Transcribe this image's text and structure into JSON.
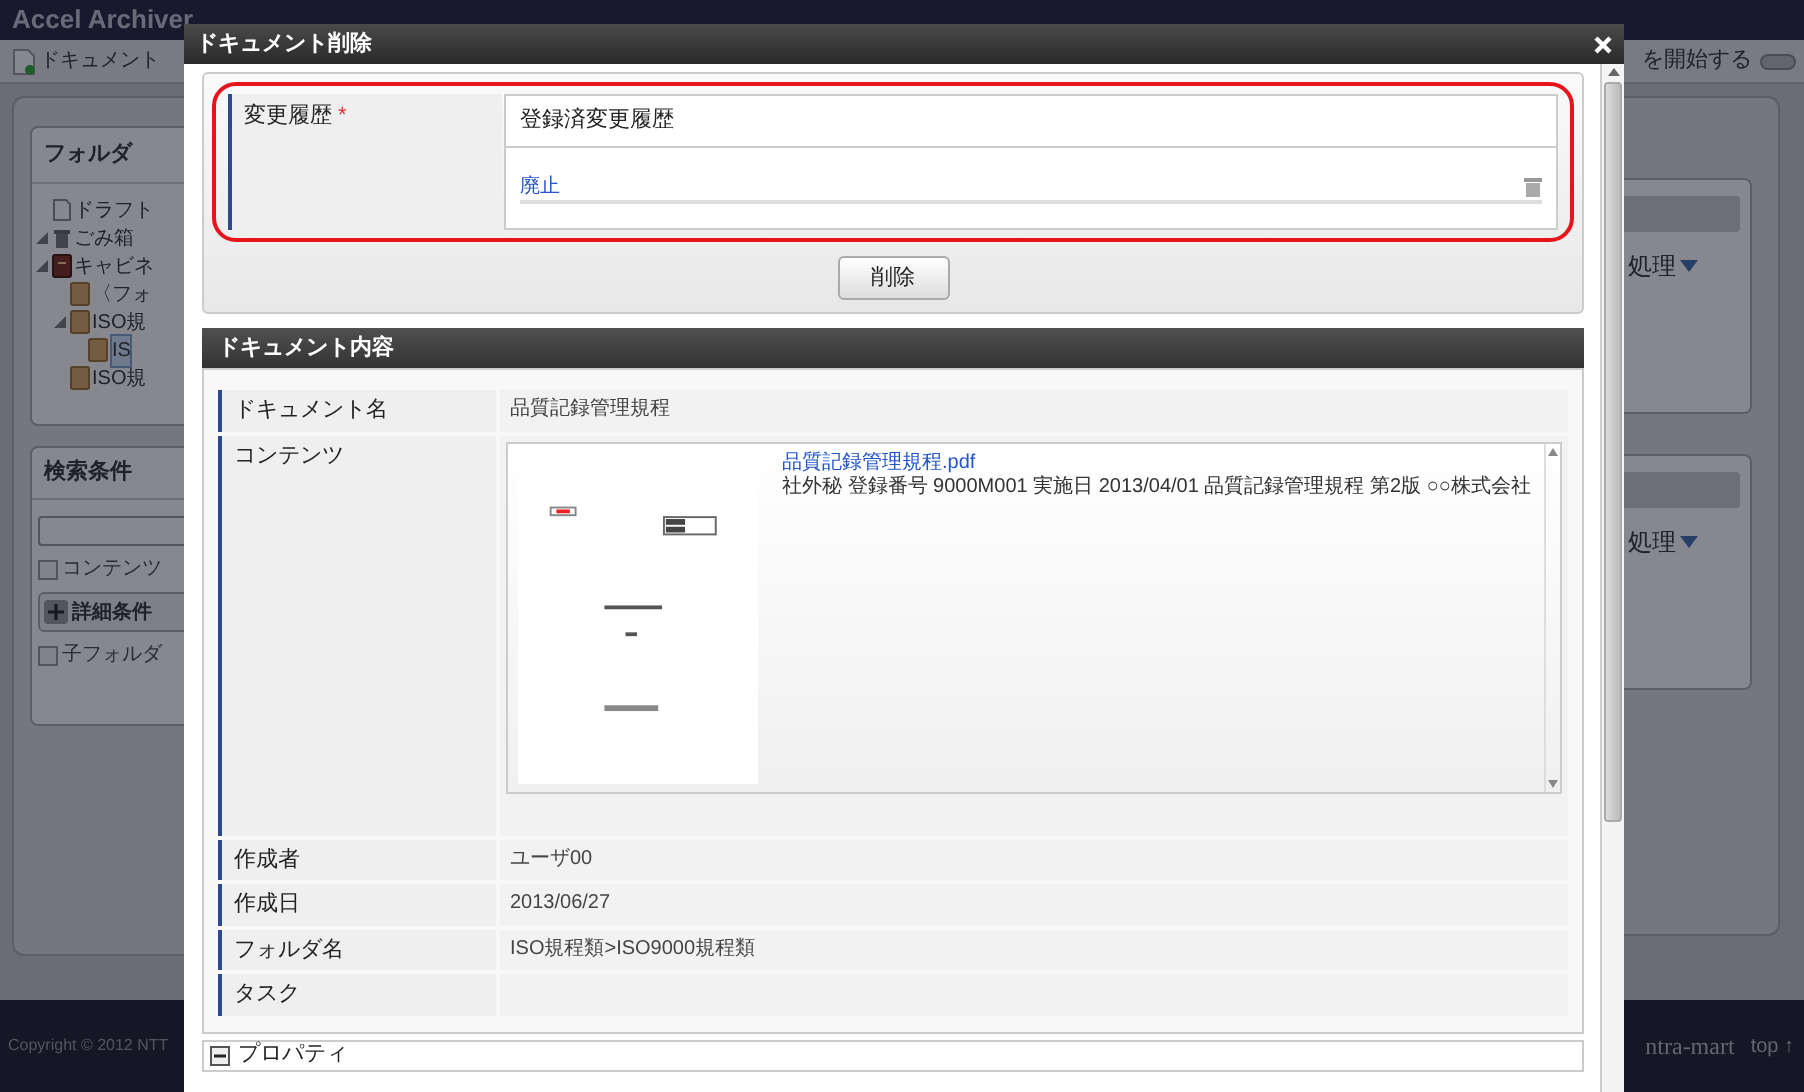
{
  "app": {
    "title": "Accel Archiver",
    "toolbar_button": "ドキュメント",
    "toolbar_right": "を開始する",
    "toolbar_toggle_on": false,
    "folder_panel": {
      "title": "フォルダ",
      "tree": [
        {
          "label": "ドラフト",
          "kind": "draft",
          "expanded": false,
          "selected": false
        },
        {
          "label": "ごみ箱",
          "kind": "trash",
          "expanded": true,
          "selected": false
        },
        {
          "label": "キャビネ",
          "kind": "cabinet",
          "expanded": true,
          "selected": false,
          "children": [
            {
              "label": "〈フォ",
              "kind": "folder",
              "expanded": false,
              "selected": false
            },
            {
              "label": "ISO規",
              "kind": "folder",
              "expanded": true,
              "selected": false,
              "children": [
                {
                  "label": "IS",
                  "kind": "folder",
                  "expanded": false,
                  "selected": true
                }
              ]
            },
            {
              "label": "ISO規",
              "kind": "folder",
              "expanded": false,
              "selected": false
            }
          ]
        }
      ]
    },
    "search_panel": {
      "title": "検索条件",
      "options": [
        {
          "kind": "checkbox",
          "label": "コンテンツ",
          "checked": false
        },
        {
          "kind": "button",
          "label": "詳細条件"
        },
        {
          "kind": "checkbox",
          "label": "子フォルダ",
          "checked": false
        }
      ]
    },
    "right_menus": [
      "処理",
      "処理"
    ],
    "footer": {
      "copyright": "Copyright © 2012 NTT",
      "logo": "ntra-mart",
      "top_link": "top ↑"
    }
  },
  "dialog": {
    "title": "ドキュメント削除",
    "history": {
      "label": "変更履歴",
      "required_mark": "*",
      "heading": "登録済変更履歴",
      "entries": [
        "廃止"
      ]
    },
    "delete_button": "削除",
    "content_section": {
      "title": "ドキュメント内容",
      "rows": [
        {
          "kind": "text",
          "label": "ドキュメント名",
          "value": "品質記録管理規程"
        },
        {
          "kind": "file",
          "label": "コンテンツ",
          "file_name": "品質記録管理規程.pdf",
          "description": "社外秘 登録番号 9000M001 実施日 2013/04/01 品質記録管理規程 第2版 ○○株式会社"
        },
        {
          "kind": "text",
          "label": "作成者",
          "value": "ユーザ00"
        },
        {
          "kind": "text",
          "label": "作成日",
          "value": "2013/06/27"
        },
        {
          "kind": "text",
          "label": "フォルダ名",
          "value": "ISO規程類>ISO9000規程類"
        },
        {
          "kind": "text",
          "label": "タスク",
          "value": ""
        }
      ]
    },
    "properties_section": {
      "title": "プロパティ",
      "expanded": true
    }
  }
}
